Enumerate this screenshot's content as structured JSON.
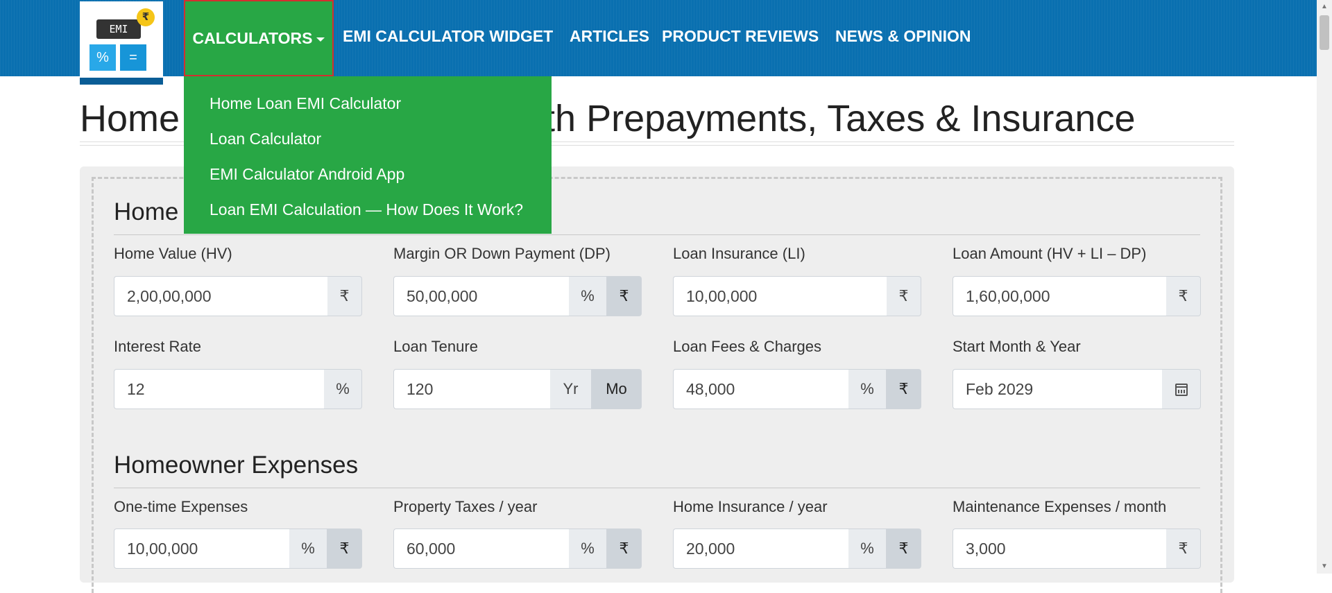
{
  "logo": {
    "screen_text": "EMI",
    "coin_symbol": "₹",
    "key_left": "%",
    "key_right": "="
  },
  "nav": {
    "calculators": "CALCULATORS",
    "widget": "EMI CALCULATOR WIDGET",
    "articles": "ARTICLES",
    "reviews": "PRODUCT REVIEWS",
    "news": "NEWS & OPINION"
  },
  "dropdown": {
    "items": [
      "Home Loan EMI Calculator",
      "Loan Calculator",
      "EMI Calculator Android App",
      "Loan EMI Calculation — How Does It Work?"
    ]
  },
  "page": {
    "title_left": "Home",
    "title_right": "with Prepayments, Taxes & Insurance"
  },
  "sections": {
    "home_loan_title": "Home",
    "expenses_title": "Homeowner Expenses"
  },
  "fields": {
    "home_value": {
      "label": "Home Value (HV)",
      "value": "2,00,00,000",
      "addon": "₹"
    },
    "down_payment": {
      "label": "Margin OR Down Payment (DP)",
      "value": "50,00,000",
      "addon_pct": "%",
      "addon_rs": "₹"
    },
    "loan_insurance": {
      "label": "Loan Insurance (LI)",
      "value": "10,00,000",
      "addon": "₹"
    },
    "loan_amount": {
      "label": "Loan Amount (HV + LI – DP)",
      "value": "1,60,00,000",
      "addon": "₹"
    },
    "interest_rate": {
      "label": "Interest Rate",
      "value": "12",
      "addon": "%"
    },
    "loan_tenure": {
      "label": "Loan Tenure",
      "value": "120",
      "addon_yr": "Yr",
      "addon_mo": "Mo"
    },
    "loan_fees": {
      "label": "Loan Fees & Charges",
      "value": "48,000",
      "addon_pct": "%",
      "addon_rs": "₹"
    },
    "start_month": {
      "label": "Start Month & Year",
      "value": "Feb 2029",
      "icon": "calendar-icon"
    },
    "one_time": {
      "label": "One-time Expenses",
      "value": "10,00,000",
      "addon_pct": "%",
      "addon_rs": "₹"
    },
    "property_taxes": {
      "label": "Property Taxes / year",
      "value": "60,000",
      "addon_pct": "%",
      "addon_rs": "₹"
    },
    "home_insurance": {
      "label": "Home Insurance / year",
      "value": "20,000",
      "addon_pct": "%",
      "addon_rs": "₹"
    },
    "maintenance": {
      "label": "Maintenance Expenses / month",
      "value": "3,000",
      "addon": "₹"
    }
  },
  "colors": {
    "navbar": "#0a70b0",
    "dropdown": "#28a745",
    "highlight_border": "#d32f2f",
    "panel": "#eeeeee"
  }
}
